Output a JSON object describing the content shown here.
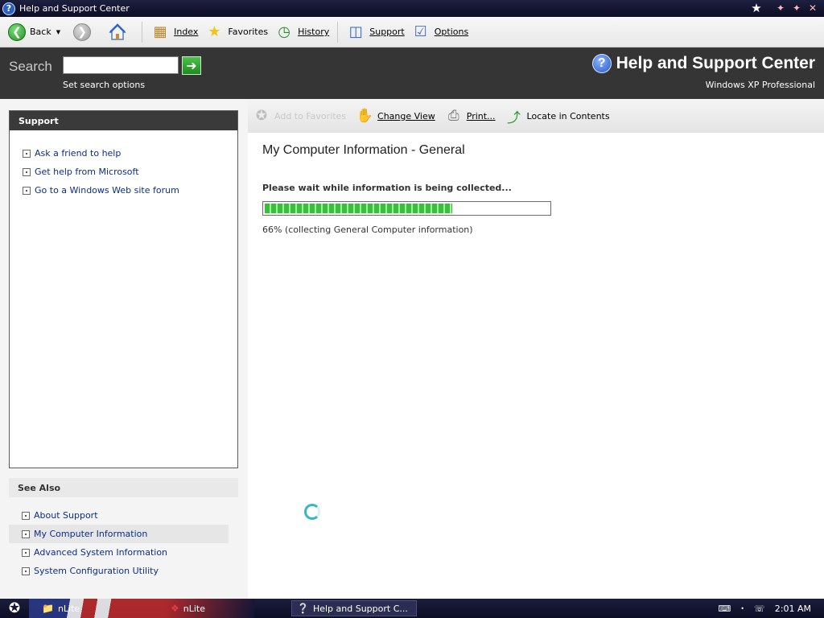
{
  "window": {
    "title": "Help and Support Center",
    "app_icon": "?",
    "controls": [
      "★",
      "✦",
      "✦",
      "✕"
    ]
  },
  "toolbar": {
    "back_label": "Back",
    "index_label": "Index",
    "favorites_label": "Favorites",
    "history_label": "History",
    "support_label": "Support",
    "options_label": "Options"
  },
  "search": {
    "label": "Search",
    "value": "",
    "options_link": "Set search options"
  },
  "header": {
    "title": "Help and Support Center",
    "edition": "Windows XP Professional"
  },
  "sidebar": {
    "support_heading": "Support",
    "support_items": [
      {
        "label": "Ask a friend to help"
      },
      {
        "label": "Get help from Microsoft"
      },
      {
        "label": "Go to a Windows Web site forum"
      }
    ],
    "see_also_heading": "See Also",
    "see_also_items": [
      {
        "label": "About Support"
      },
      {
        "label": "My Computer Information"
      },
      {
        "label": "Advanced System Information"
      },
      {
        "label": "System Configuration Utility"
      }
    ]
  },
  "content_toolbar": {
    "add_favorites_label": "Add to Favorites",
    "change_view_label": "Change View",
    "print_label": "Print...",
    "locate_label": "Locate in Contents"
  },
  "main": {
    "page_title": "My Computer Information - General",
    "wait_message": "Please wait while information is being collected...",
    "progress_value": 0.66,
    "progress_text": "66%  (collecting General Computer information)"
  },
  "taskbar": {
    "tasks": [
      {
        "label": "nLite"
      },
      {
        "label": "nLite"
      },
      {
        "label": "Help and Support C..."
      }
    ],
    "clock": "2:01 AM"
  },
  "colors": {
    "banner_bg": "#353535",
    "link_color": "#0b2e8a",
    "progress_green": "#36c236",
    "titlebar_bg": "#0b0d25"
  }
}
